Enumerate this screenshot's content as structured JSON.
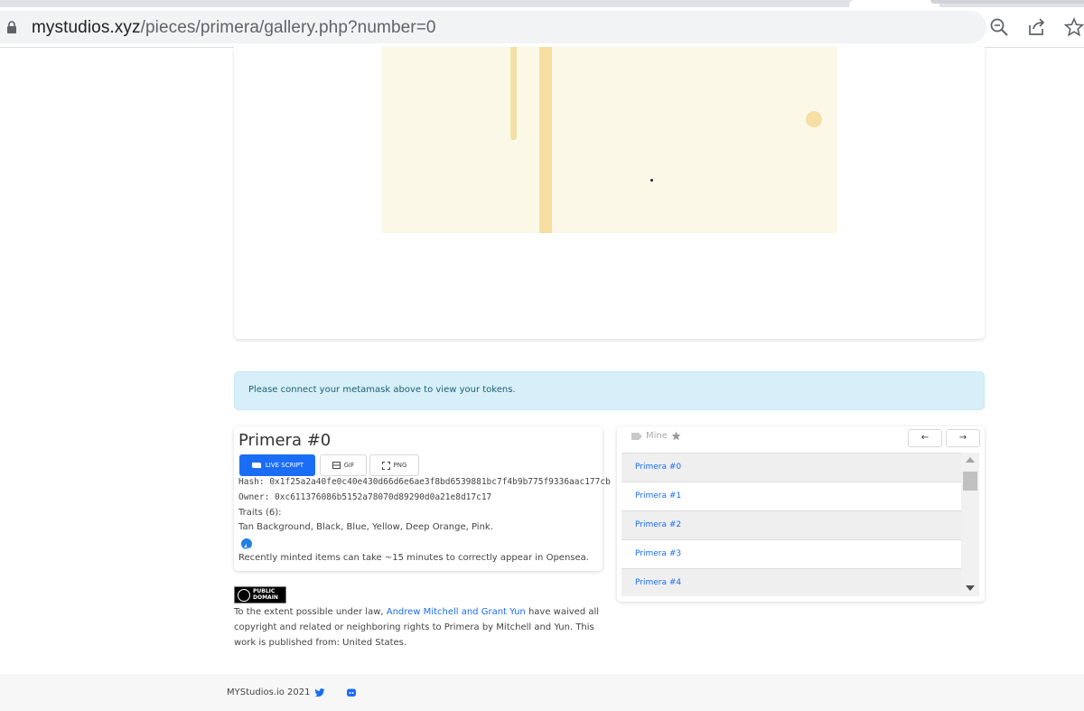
{
  "browser": {
    "url_domain": "mystudios.xyz",
    "url_path": "/pieces/primera/gallery.php?number=0"
  },
  "alert": {
    "text": "Please connect your metamask above to view your tokens."
  },
  "piece": {
    "title": "Primera #0",
    "buttons": {
      "live_script": "LIVE SCRIPT",
      "gif": "GIF",
      "png": "PNG"
    },
    "hash": "Hash: 0x1f25a2a40fe0c40e430d66d6e6ae3f8bd6539881bc7f4b9b775f9336aac177cb",
    "owner": "Owner: 0xc611376086b5152a78070d89290d0a21e8d17c17",
    "traits_header": "Traits (6):",
    "traits": "Tan Background, Black, Blue, Yellow, Deep Orange, Pink.",
    "opensea_note": "Recently minted items can take ~15 minutes to correctly appear in Opensea."
  },
  "license": {
    "badge_line1": "PUBLIC",
    "badge_line2": "DOMAIN",
    "text_before": "To the extent possible under law, ",
    "authors_link": "Andrew Mitchell and Grant Yun",
    "text_after": " have waived all copyright and related or neighboring rights to Primera by Mitchell and Yun. This work is published from: United States."
  },
  "list_panel": {
    "mine_label": "Mine",
    "prev_arrow": "←",
    "next_arrow": "→",
    "items": [
      "Primera #0",
      "Primera #1",
      "Primera #2",
      "Primera #3",
      "Primera #4"
    ]
  },
  "footer": {
    "copyright": "MYStudios.io 2021"
  },
  "colors": {
    "accent": "#1a6ef5",
    "artwork_background": "#fcf8e8",
    "artwork_stripe": "#f4dfa0",
    "alert_background": "#d6eff8"
  },
  "icons": [
    "lock-icon",
    "zoom-icon",
    "share-icon",
    "star-icon",
    "scroll-icon",
    "image-icon",
    "expand-icon",
    "opensea-icon",
    "tag-icon",
    "twitter-icon",
    "discord-icon"
  ]
}
